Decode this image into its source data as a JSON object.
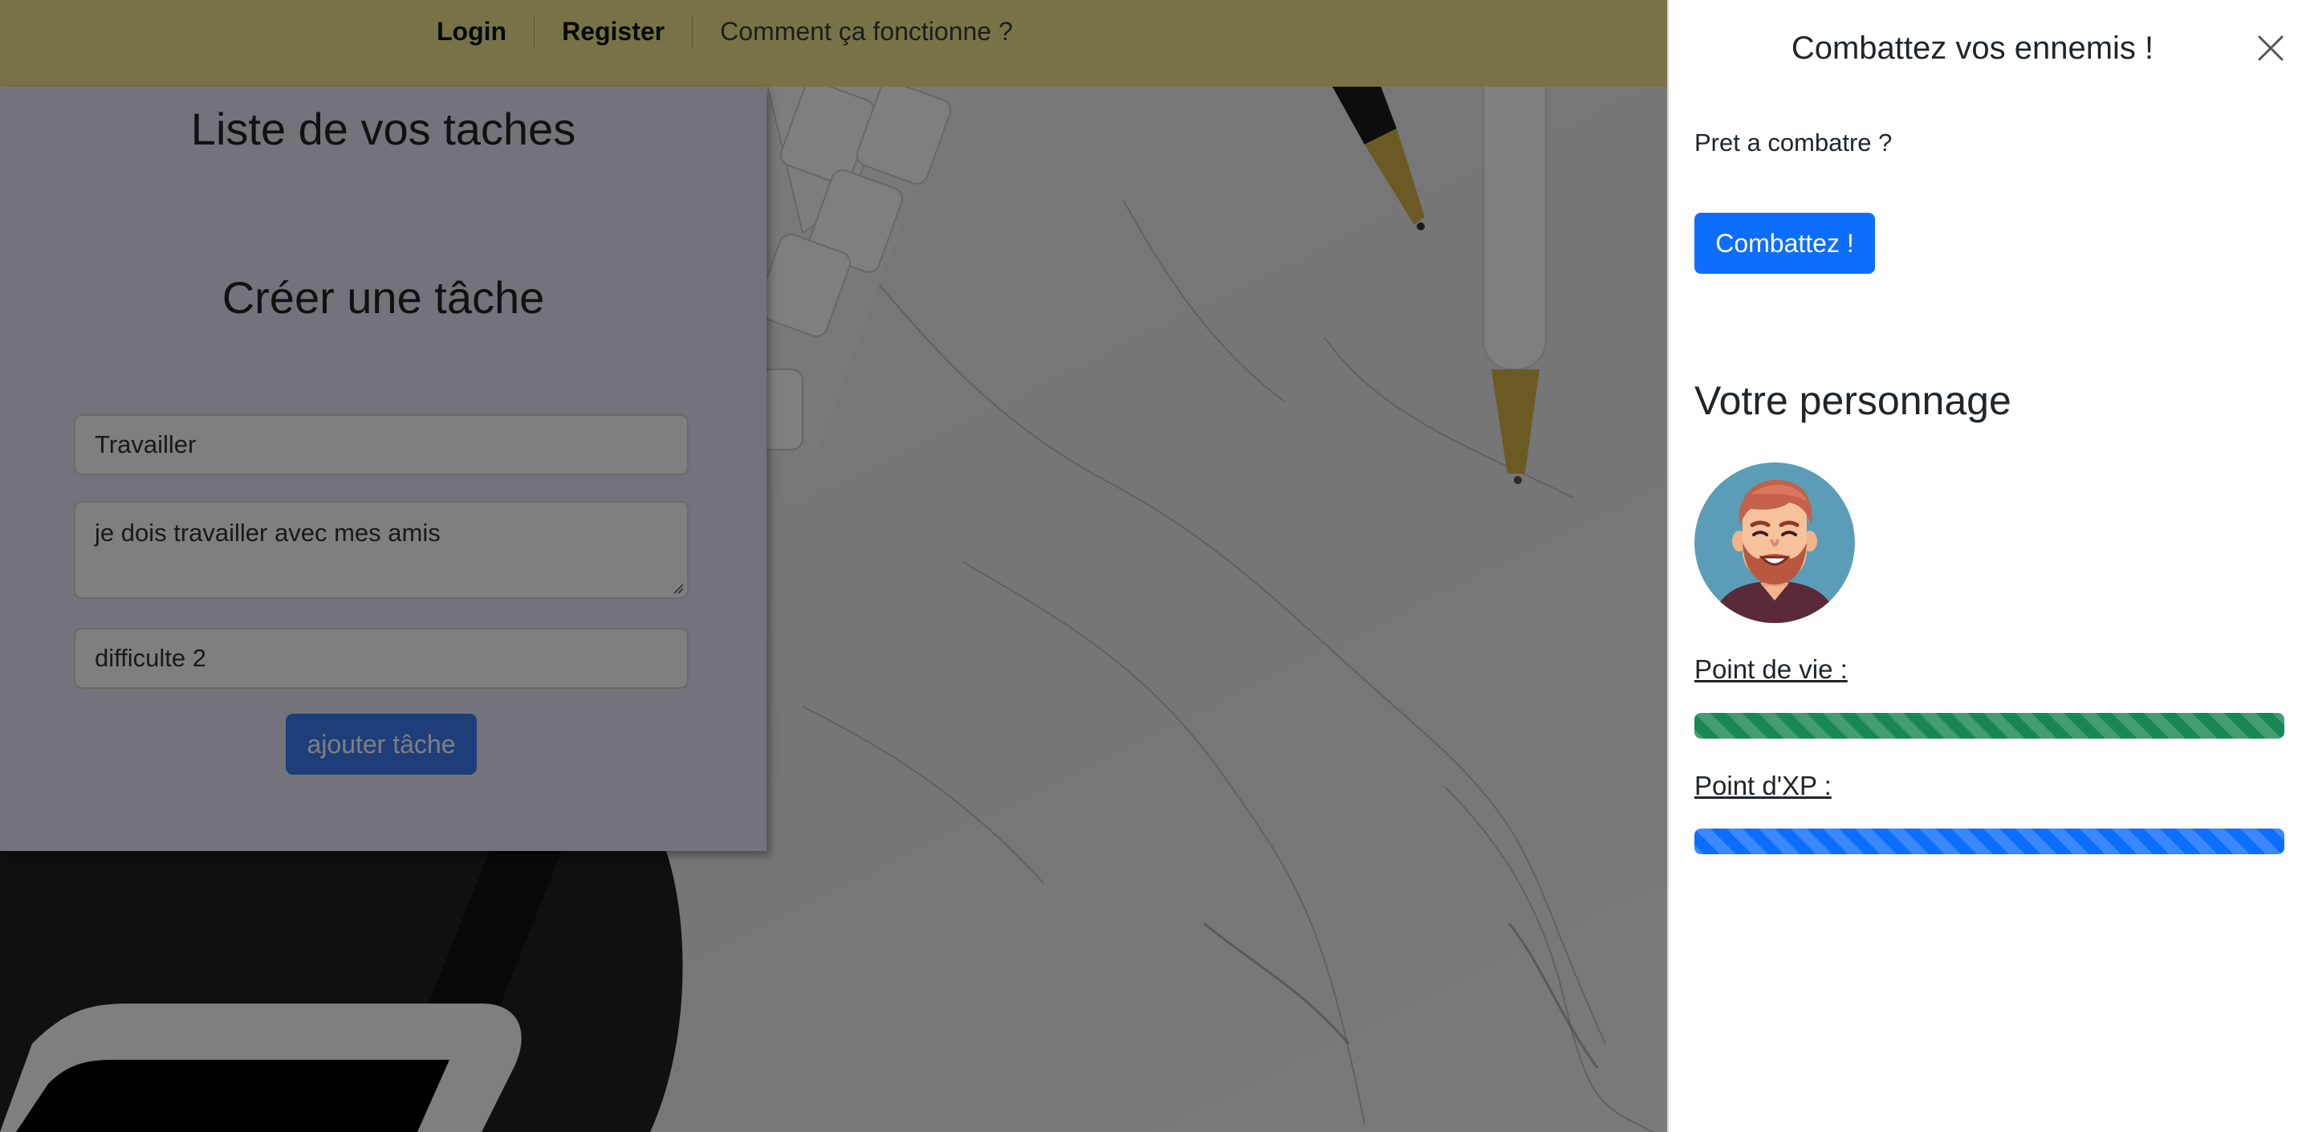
{
  "navbar": {
    "login": "Login",
    "register": "Register",
    "how_it_works": "Comment ça fonctionne ?"
  },
  "task_panel": {
    "title": "Liste de vos taches",
    "create_title": "Créer une tâche",
    "name_value": "Travailler",
    "description_value": "je dois travailler avec mes amis",
    "difficulty_value": "difficulte 2",
    "add_button": "ajouter tâche"
  },
  "offcanvas": {
    "title": "Combattez vos ennemis !",
    "ready_text": "Pret a combatre ?",
    "fight_button": "Combattez !",
    "character_title": "Votre personnage",
    "hp_label": "Point de vie :",
    "xp_label": "Point d'XP :",
    "hp_percent": 100,
    "xp_percent": 100
  },
  "colors": {
    "navbar_bg": "#f0e68c",
    "task_panel_bg": "#e9e6f9",
    "primary": "#0d6efd",
    "hp_bar": "#198754",
    "xp_bar": "#0d6efd",
    "avatar_bg": "#5b9db7"
  },
  "icons": {
    "close": "close-icon",
    "avatar": "avatar-bearded-man"
  }
}
